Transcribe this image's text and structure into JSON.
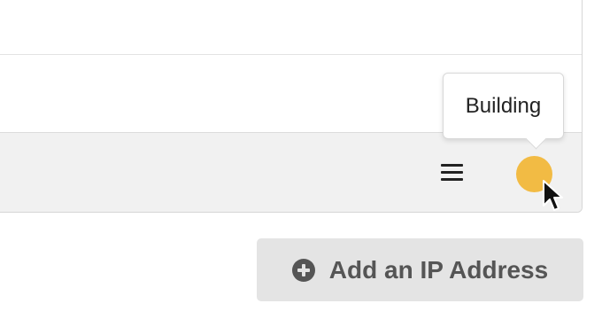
{
  "table": {
    "rows": [
      {
        "id": "row-1"
      },
      {
        "id": "row-2"
      }
    ],
    "footer": {
      "menu_icon": "hamburger-menu-icon",
      "status_icon": "status-dot-icon"
    }
  },
  "tooltip": {
    "text": "Building"
  },
  "status": {
    "color": "#f2bb44"
  },
  "actions": {
    "add_ip_label": "Add an IP Address",
    "add_ip_icon": "plus-circle-icon"
  },
  "colors": {
    "button_bg": "#e4e4e4",
    "button_text": "#555555",
    "footer_bg": "#f1f1f1"
  }
}
